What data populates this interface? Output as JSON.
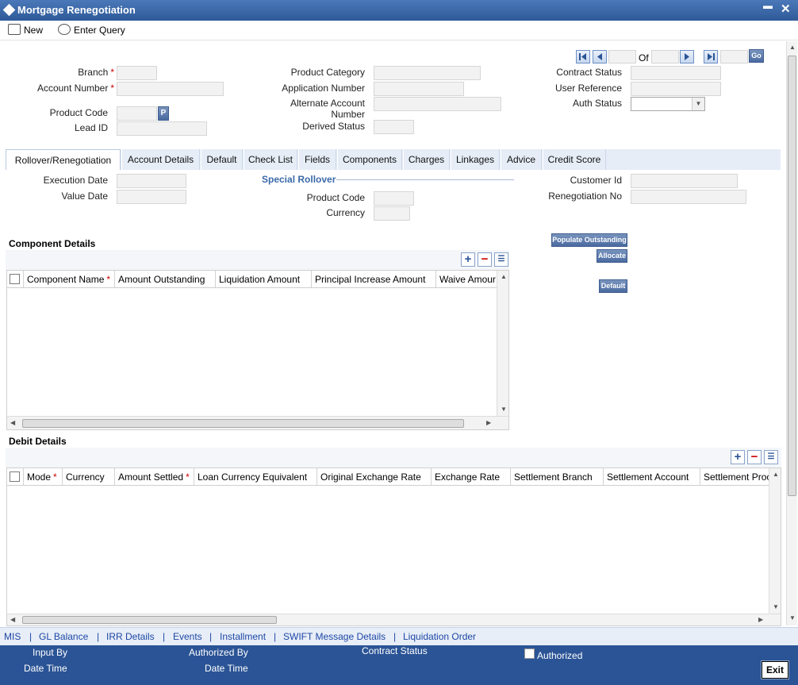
{
  "window": {
    "title": "Mortgage Renegotiation",
    "minimize_label": "▬",
    "close_label": "✕"
  },
  "toolbar": {
    "new_label": "New",
    "enter_query_label": "Enter Query"
  },
  "header": {
    "branch_label": "Branch",
    "account_number_label": "Account Number",
    "product_code_label": "Product Code",
    "product_button_label": "P",
    "lead_id_label": "Lead ID",
    "product_category_label": "Product Category",
    "application_number_label": "Application Number",
    "alternate_account_number_label": "Alternate Account Number",
    "derived_status_label": "Derived Status",
    "contract_status_label": "Contract Status",
    "user_reference_label": "User Reference",
    "auth_status_label": "Auth Status",
    "of_label": "Of",
    "go_label": "Go"
  },
  "tabs": [
    {
      "label": "Rollover/Renegotiation",
      "active": true
    },
    {
      "label": "Account Details"
    },
    {
      "label": "Default"
    },
    {
      "label": "Check List"
    },
    {
      "label": "Fields"
    },
    {
      "label": "Components"
    },
    {
      "label": "Charges"
    },
    {
      "label": "Linkages"
    },
    {
      "label": "Advice"
    },
    {
      "label": "Credit Score"
    }
  ],
  "rollover": {
    "execution_date_label": "Execution Date",
    "value_date_label": "Value Date",
    "special_rollover_label": "Special Rollover",
    "product_code_label": "Product Code",
    "currency_label": "Currency",
    "customer_id_label": "Customer Id",
    "renegotiation_no_label": "Renegotiation No"
  },
  "component_details": {
    "title": "Component Details",
    "columns": [
      "Component Name",
      "Amount Outstanding",
      "Liquidation Amount",
      "Principal Increase Amount",
      "Waive Amour"
    ],
    "populate_outstanding_label": "Populate Outstanding",
    "allocate_label": "Allocate",
    "default_label": "Default"
  },
  "debit_details": {
    "title": "Debit Details",
    "columns": [
      "Mode",
      "Currency",
      "Amount Settled",
      "Loan Currency Equivalent",
      "Original Exchange Rate",
      "Exchange Rate",
      "Settlement Branch",
      "Settlement Account",
      "Settlement Proc"
    ]
  },
  "links": [
    "MIS",
    "GL Balance",
    "IRR Details",
    "Events",
    "Installment",
    "SWIFT Message Details",
    "Liquidation Order"
  ],
  "link_separator": "|",
  "footer": {
    "input_by_label": "Input By",
    "date_time_label": "Date Time",
    "authorized_by_label": "Authorized By",
    "date_time2_label": "Date Time",
    "contract_status_label": "Contract Status",
    "authorized_label": "Authorized",
    "exit_label": "Exit"
  },
  "colors": {
    "title_bar": "#2f5a99",
    "footer": "#2b5496",
    "link": "#1d47a6",
    "section_title": "#3b6aa8"
  }
}
